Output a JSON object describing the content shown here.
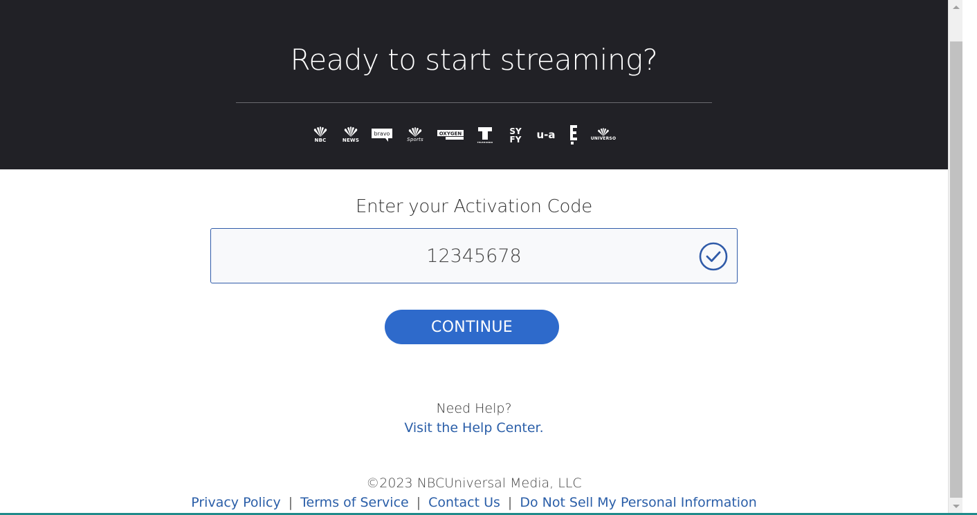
{
  "hero": {
    "title": "Ready to start streaming?",
    "logos": [
      {
        "icon": "nbc-peacock-icon",
        "label": "NBC"
      },
      {
        "icon": "nbc-news-icon",
        "label": "NEWS"
      },
      {
        "icon": "bravo-icon",
        "label": "bravo"
      },
      {
        "icon": "nbc-sports-icon",
        "label": "Sports"
      },
      {
        "icon": "oxygen-icon",
        "label": "OXYGEN"
      },
      {
        "icon": "telemundo-icon",
        "label": "TELEMUNDO"
      },
      {
        "icon": "syfy-icon",
        "label": "SY FY"
      },
      {
        "icon": "usa-icon",
        "label": "u-a"
      },
      {
        "icon": "e-icon",
        "label": "E"
      },
      {
        "icon": "universo-icon",
        "label": "UNIVERSO"
      }
    ]
  },
  "activation": {
    "prompt": "Enter your Activation Code",
    "code_value": "12345678",
    "check_icon": "check-circle-icon",
    "continue_label": "CONTINUE"
  },
  "help": {
    "question": "Need Help?",
    "link": "Visit the Help Center."
  },
  "footer": {
    "copyright": "©2023 NBCUniversal Media, LLC",
    "links": [
      "Privacy Policy",
      "Terms of Service",
      "Contact Us",
      "Do Not Sell My Personal Information"
    ],
    "separator": "|"
  },
  "colors": {
    "hero_bg": "#212126",
    "accent": "#2e6acb",
    "link": "#2a5ea8"
  }
}
